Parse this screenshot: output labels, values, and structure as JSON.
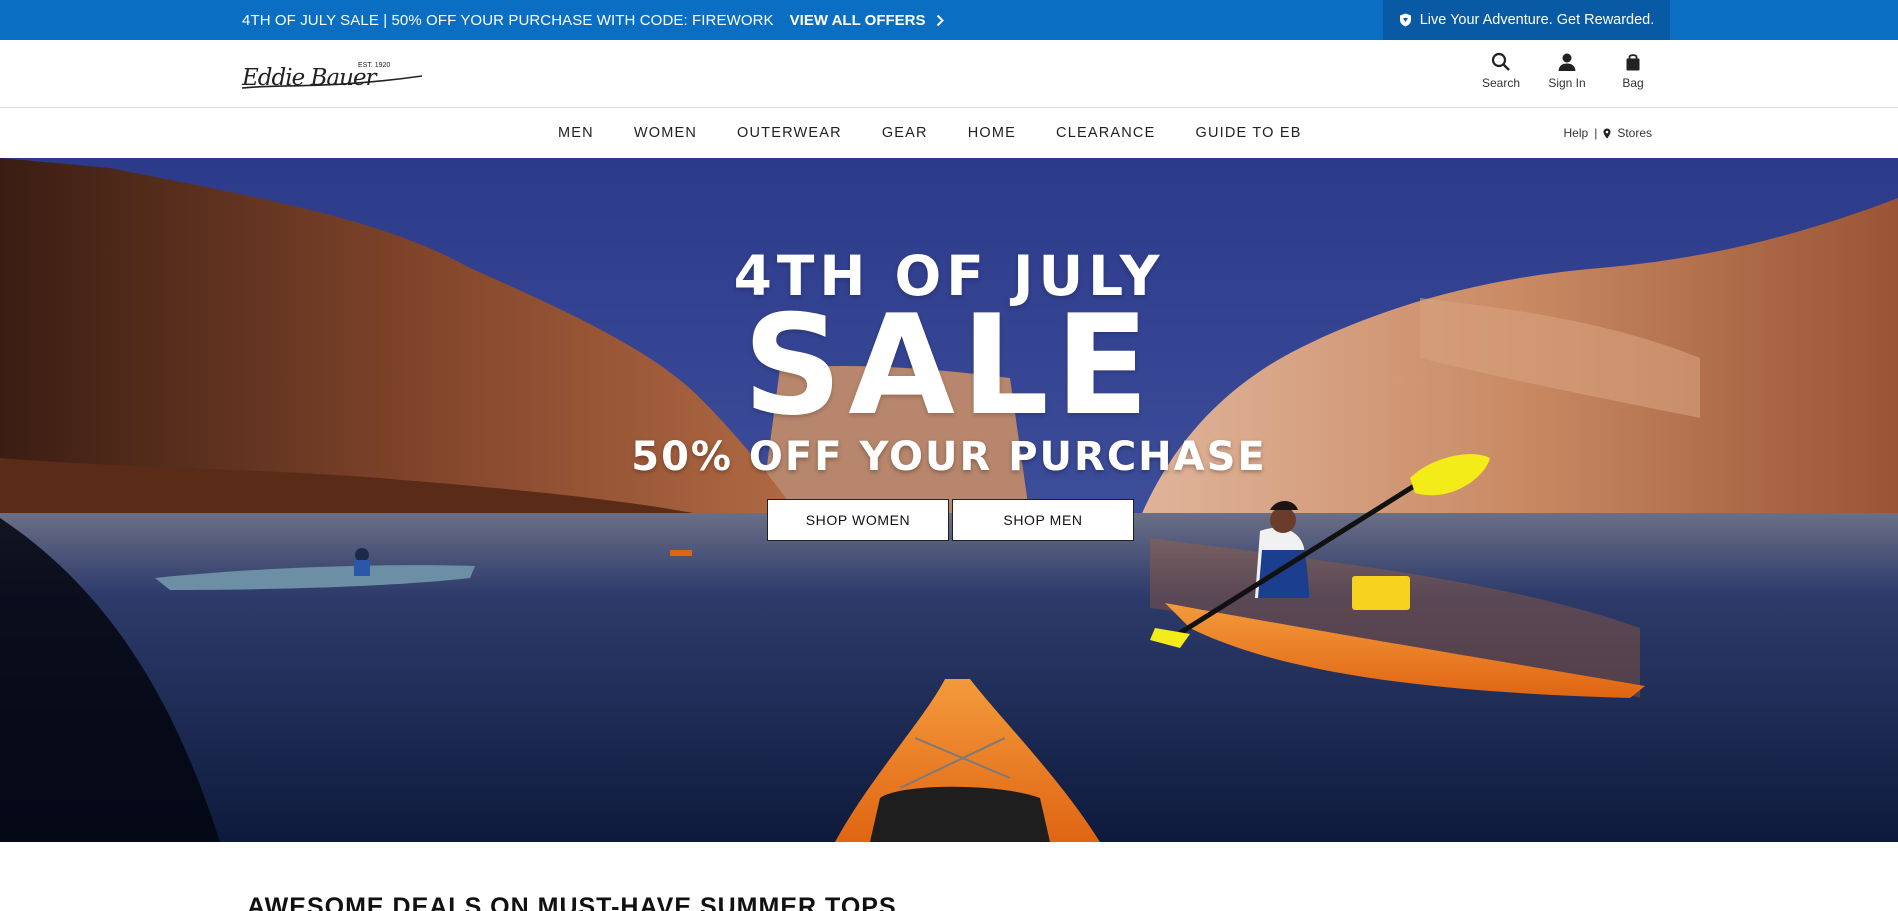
{
  "promo_bar": {
    "text": "4TH OF JULY SALE | 50% OFF YOUR PURCHASE WITH CODE: FIREWORK",
    "link_label": "VIEW ALL OFFERS",
    "rewards_text": "Live Your Adventure. Get Rewarded."
  },
  "header": {
    "logo_alt": "Eddie Bauer",
    "logo_est": "EST. 1920",
    "tools": [
      {
        "label": "Search",
        "icon": "search-icon"
      },
      {
        "label": "Sign In",
        "icon": "user-icon"
      },
      {
        "label": "Bag",
        "icon": "bag-icon"
      }
    ]
  },
  "nav": {
    "items": [
      "MEN",
      "WOMEN",
      "OUTERWEAR",
      "GEAR",
      "HOME",
      "CLEARANCE",
      "GUIDE TO EB"
    ],
    "help": "Help",
    "separator": "|",
    "stores": "Stores"
  },
  "hero": {
    "kicker": "4TH OF JULY",
    "headline": "SALE",
    "subhead": "50% OFF YOUR PURCHASE",
    "buttons": [
      "SHOP WOMEN",
      "SHOP MEN"
    ]
  },
  "section": {
    "title": "AWESOME DEALS ON MUST-HAVE SUMMER TOPS"
  },
  "colors": {
    "promo_blue": "#0a6fc2",
    "rewards_blue": "#075aa3",
    "kayak_orange": "#f07a1f"
  }
}
